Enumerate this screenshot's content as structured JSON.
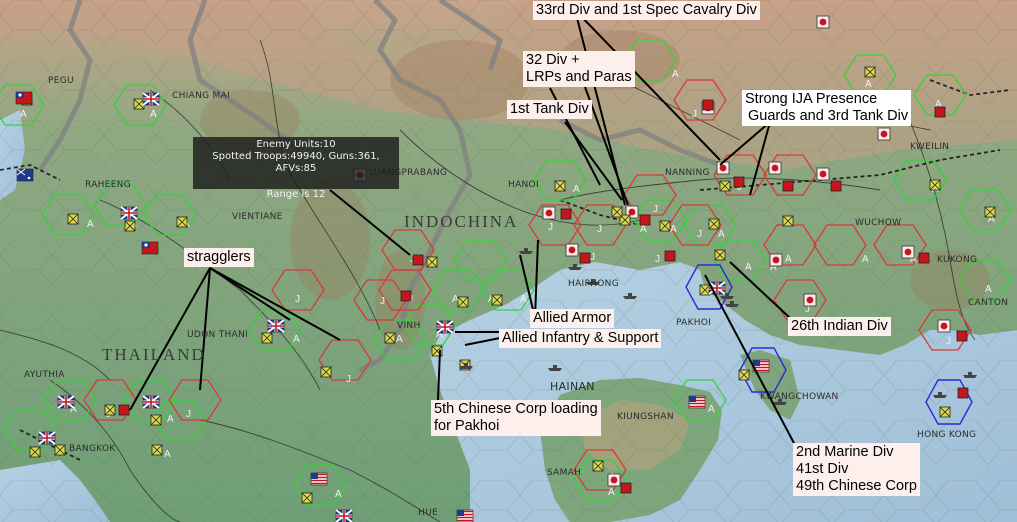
{
  "tooltip": {
    "enemy_units": "Enemy Units:10",
    "spotted": "Spotted Troops:49940, Guns:361, AFVs:85",
    "range": "Range is 12"
  },
  "places": {
    "pegu": "PEGU",
    "chiang_mai": "CHIANG MAI",
    "raheeng": "RAHEENG",
    "vientiane": "VIENTIANE",
    "luangprabang": "LUANGPRABANG",
    "hanoi": "HANOI",
    "nanning": "NANNING",
    "kweilin": "KWEILIN",
    "wuchow": "WUCHOW",
    "kukong": "KUKONG",
    "canton": "CANTON",
    "haiphong": "HAIPHONG",
    "pakhoi": "PAKHOI",
    "vinh": "VINH",
    "udon_thani": "UDON THANI",
    "ayuthia": "AYUTHIA",
    "bangkok": "BANGKOK",
    "hainan": "HAINAN",
    "kiungshan": "KIUNGSHAN",
    "kwangchowan": "KWANGCHOWAN",
    "hong_kong": "HONG KONG",
    "samah": "SAMAH",
    "hue": "HUE"
  },
  "regions": {
    "indochina": "INDOCHINA",
    "thailand": "THAILAND"
  },
  "annotations": {
    "cavalry": "33rd Div and 1st Spec Cavalry Div",
    "div32_line1": "32 Div +",
    "div32_line2": "LRPs and Paras",
    "tank": "1st Tank Div",
    "ija_line1": "Strong IJA Presence",
    "ija_line2": "Guards and 3rd Tank Div",
    "stragglers": "stragglers",
    "allied_armor": "Allied Armor",
    "allied_infantry": "Allied Infantry & Support",
    "indian": "26th Indian Div",
    "chinese_line1": "5th Chinese Corp loading",
    "chinese_line2": "for Pakhoi",
    "marine_line1": "2nd Marine Div",
    "marine_line2": "41st Div",
    "marine_line3": "49th Chinese Corp"
  },
  "hex_labels": {
    "allied": "A",
    "japanese": "J"
  },
  "colors": {
    "sea": "#aac6dc",
    "allied_hex": "#35d23a",
    "japanese_hex": "#d83a3a",
    "note_bg": "#fdf0ec",
    "unit_red": "#c4161c",
    "unit_yellow": "#d9d94a"
  },
  "icons": [
    "japan-flag-icon",
    "uk-flag-icon",
    "us-flag-icon",
    "china-flag-icon",
    "australia-flag-icon",
    "japanese-unit-icon",
    "allied-unit-icon",
    "ship-icon"
  ]
}
